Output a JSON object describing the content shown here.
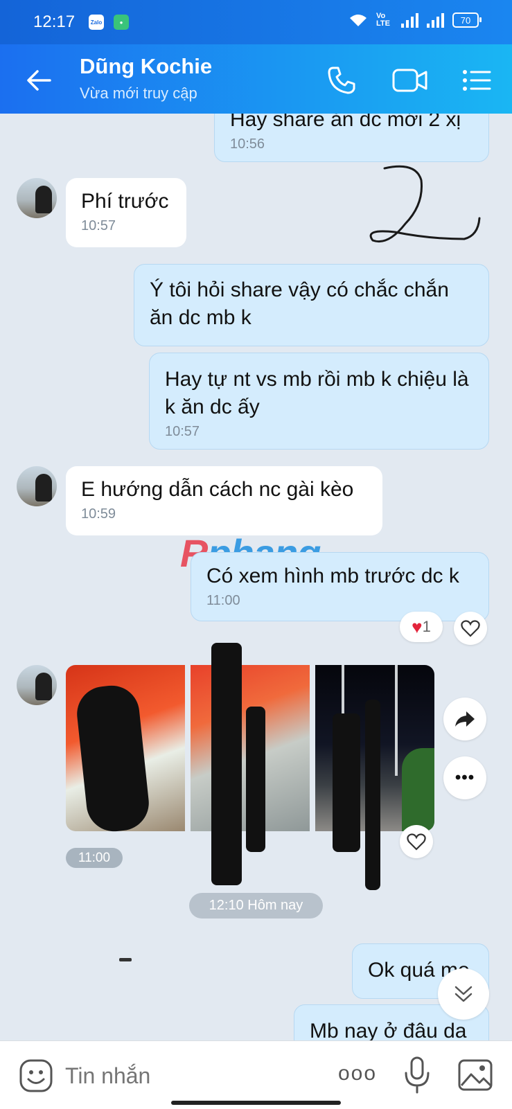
{
  "status_bar": {
    "time": "12:17",
    "app1": "Zalo",
    "network": "Vo LTE",
    "battery": "70"
  },
  "header": {
    "contact_name": "Dũng Kochie",
    "presence": "Vừa mới truy cập"
  },
  "messages": [
    {
      "text": "Hay share ăn dc mới 2 xị",
      "time": "10:56"
    },
    {
      "text": "Phí trước",
      "time": "10:57"
    },
    {
      "text": "Ý tôi hỏi share vậy có chắc chắn ăn dc mb k"
    },
    {
      "text": "Hay tự nt vs mb rồi mb k chiệu là k ăn dc ấy",
      "time": "10:57"
    },
    {
      "text": "E hướng dẫn cách nc gài kèo",
      "time": "10:59"
    },
    {
      "text": "Có xem hình mb trước dc k",
      "time": "11:00",
      "reaction_count": "1"
    },
    {
      "text": "Ok quá mo"
    },
    {
      "text": "Mb nay ở đâu da"
    }
  ],
  "photos_time": "11:00",
  "date_separator": "12:10 Hôm nay",
  "watermark": {
    "part1": "R",
    "part2": "phang"
  },
  "composer": {
    "placeholder": "Tin nhắn",
    "more": "ooo"
  },
  "colors": {
    "accent": "#1a7cf0",
    "outgoing_bubble": "#d4ecfd",
    "incoming_bubble": "#ffffff",
    "background": "#e2e9f1"
  }
}
